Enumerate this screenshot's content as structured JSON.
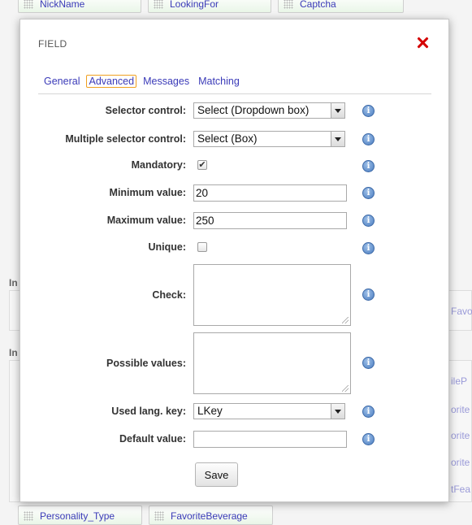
{
  "background": {
    "top_fields": [
      "NickName",
      "LookingFor",
      "Captcha"
    ],
    "section_labels": [
      "In",
      "In"
    ],
    "bottom_fields": [
      "Personality_Type",
      "FavoriteBeverage"
    ],
    "right_fragments": [
      "Favo",
      "ileP",
      "orite",
      "orite",
      "orite",
      "tFea"
    ]
  },
  "modal": {
    "title": "FIELD",
    "tabs": [
      {
        "label": "General"
      },
      {
        "label": "Advanced"
      },
      {
        "label": "Messages"
      },
      {
        "label": "Matching"
      }
    ],
    "active_tab": "Advanced",
    "fields": {
      "selector_control": {
        "label": "Selector control:",
        "value": "Select (Dropdown box)"
      },
      "multiple_selector_control": {
        "label": "Multiple selector control:",
        "value": "Select (Box)"
      },
      "mandatory": {
        "label": "Mandatory:",
        "checked": true,
        "mark": "✔"
      },
      "minimum_value": {
        "label": "Minimum value:",
        "value": "20"
      },
      "maximum_value": {
        "label": "Maximum value:",
        "value": "250"
      },
      "unique": {
        "label": "Unique:",
        "checked": false
      },
      "check": {
        "label": "Check:",
        "value": ""
      },
      "possible_values": {
        "label": "Possible values:",
        "value": ""
      },
      "used_lang_key": {
        "label": "Used lang. key:",
        "value": "LKey"
      },
      "default_value": {
        "label": "Default value:",
        "value": ""
      }
    },
    "save_label": "Save"
  },
  "colors": {
    "link": "#3a3ab8",
    "close": "#d40000",
    "active_tab_border": "#f0a020"
  },
  "icons": {
    "info": "info-icon",
    "close": "close-icon"
  }
}
